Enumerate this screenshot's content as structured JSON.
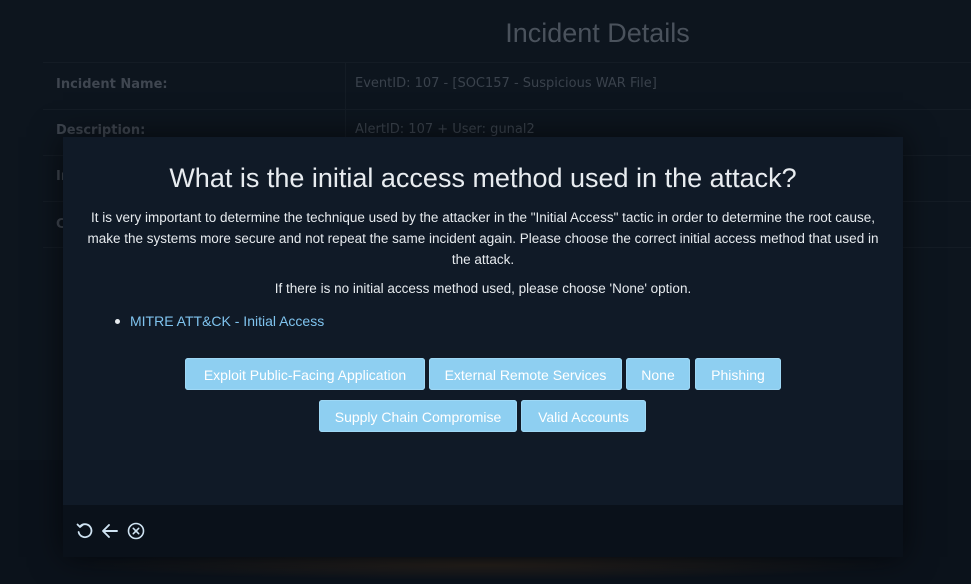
{
  "background": {
    "page_title": "Incident Details",
    "rows": [
      {
        "label": "Incident Name:",
        "value": "EventID: 107 - [SOC157 - Suspicious WAR File]"
      },
      {
        "label": "Description:",
        "value": "AlertID: 107 + User: gunal2"
      }
    ],
    "stub_labels": [
      "In",
      "C"
    ]
  },
  "modal": {
    "question": "What is the initial access method used in the attack?",
    "description": "It is very important to determine the technique used by the attacker in the \"Initial Access\" tactic in order to determine the root cause, make the systems more secure and not repeat the same incident again. Please choose the correct initial access method that used in the attack.",
    "note": "If there is no initial access method used, please choose 'None' option.",
    "reference_link": "MITRE ATT&CK - Initial Access",
    "options": [
      "Exploit Public-Facing Application",
      "External Remote Services",
      "None",
      "Phishing",
      "Supply Chain Compromise",
      "Valid Accounts"
    ],
    "footer_icons": [
      "refresh-icon",
      "back-arrow-icon",
      "close-circle-icon"
    ]
  },
  "colors": {
    "button_bg": "#8ecff1",
    "link": "#7fc3ee",
    "modal_bg": "#101a27"
  }
}
